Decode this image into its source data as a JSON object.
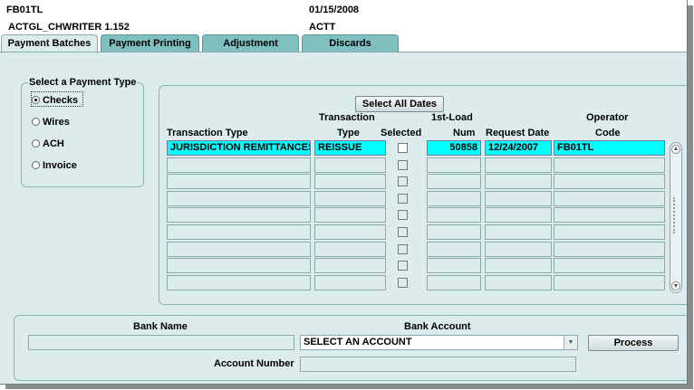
{
  "header": {
    "user": "FB01TL",
    "date": "01/15/2008",
    "version": "ACTGL_CHWRITER 1.152",
    "dept": "ACTT"
  },
  "tabs": [
    {
      "label": "Payment Batches",
      "active": true
    },
    {
      "label": "Payment Printing",
      "active": false
    },
    {
      "label": "Adjustment",
      "active": false
    },
    {
      "label": "Discards",
      "active": false
    }
  ],
  "payment_type": {
    "title": "Select a Payment Type",
    "options": [
      {
        "label": "Checks",
        "selected": true
      },
      {
        "label": "Wires",
        "selected": false
      },
      {
        "label": "ACH",
        "selected": false
      },
      {
        "label": "Invoice",
        "selected": false
      }
    ]
  },
  "grid": {
    "select_all_label": "Select All Dates",
    "headers": {
      "transaction_type": "Transaction Type",
      "trans_type_1": "Transaction",
      "trans_type_2": "Type",
      "selected": "Selected",
      "load_1": "1st-Load",
      "load_2": "Num",
      "request_date": "Request Date",
      "operator_1": "Operator",
      "operator_2": "Code"
    },
    "rows": [
      {
        "transaction_type": "JURISDICTION REMITTANCES",
        "type": "REISSUE",
        "selected": false,
        "load_num": "50858",
        "request_date": "12/24/2007",
        "operator": "FB01TL"
      },
      {
        "transaction_type": "",
        "type": "",
        "selected": false,
        "load_num": "",
        "request_date": "",
        "operator": ""
      },
      {
        "transaction_type": "",
        "type": "",
        "selected": false,
        "load_num": "",
        "request_date": "",
        "operator": ""
      },
      {
        "transaction_type": "",
        "type": "",
        "selected": false,
        "load_num": "",
        "request_date": "",
        "operator": ""
      },
      {
        "transaction_type": "",
        "type": "",
        "selected": false,
        "load_num": "",
        "request_date": "",
        "operator": ""
      },
      {
        "transaction_type": "",
        "type": "",
        "selected": false,
        "load_num": "",
        "request_date": "",
        "operator": ""
      },
      {
        "transaction_type": "",
        "type": "",
        "selected": false,
        "load_num": "",
        "request_date": "",
        "operator": ""
      },
      {
        "transaction_type": "",
        "type": "",
        "selected": false,
        "load_num": "",
        "request_date": "",
        "operator": ""
      },
      {
        "transaction_type": "",
        "type": "",
        "selected": false,
        "load_num": "",
        "request_date": "",
        "operator": ""
      }
    ]
  },
  "bank": {
    "name_label": "Bank Name",
    "name_value": "",
    "account_label": "Bank Account",
    "account_value": "SELECT AN ACCOUNT",
    "process_label": "Process",
    "account_number_label": "Account Number",
    "account_number_value": ""
  },
  "colors": {
    "highlight": "#00ffff",
    "tab": "#7fbfbf",
    "background": "#dcecec"
  }
}
